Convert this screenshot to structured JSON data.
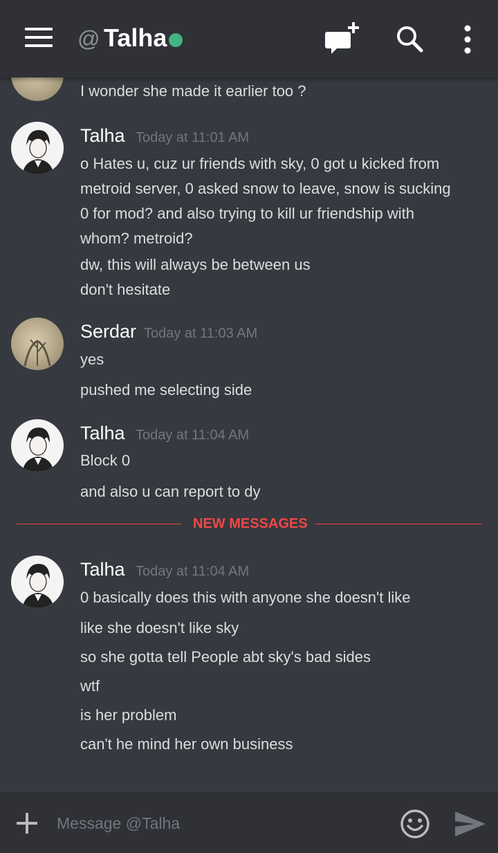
{
  "header": {
    "at_prefix": "@",
    "title": "Talha",
    "status": "online",
    "status_color": "#43b581",
    "icons": [
      "menu-icon",
      "new-dm-icon",
      "search-icon",
      "more-icon"
    ]
  },
  "messages": [
    {
      "author": "",
      "timestamp": "",
      "lines": [
        "I wonder she made it earlier too ?"
      ]
    },
    {
      "author": "Talha",
      "timestamp": "Today at 11:01 AM",
      "lines": [
        "o Hates u, cuz ur friends with sky, 0 got u kicked from",
        "metroid server, 0 asked snow to leave, snow is sucking",
        "0 for mod? and also trying to kill ur friendship with",
        "whom? metroid?",
        "dw, this will always be between us",
        "don't hesitate"
      ]
    },
    {
      "author": "Serdar",
      "timestamp": "Today at 11:03 AM",
      "lines": [
        "yes",
        "pushed me selecting side"
      ]
    },
    {
      "author": "Talha",
      "timestamp": "Today at 11:04 AM",
      "lines": [
        "Block 0",
        "and also u can report to dy"
      ]
    },
    {
      "author": "Talha",
      "timestamp": "Today at 11:04 AM",
      "lines": [
        "0 basically does this with anyone she doesn't like",
        "like she doesn't like sky",
        "so she gotta tell People abt sky's bad sides",
        "wtf",
        "is her problem",
        "can't he mind her own business"
      ]
    }
  ],
  "divider": {
    "label": "NEW MESSAGES",
    "color": "#f04747"
  },
  "composer": {
    "placeholder": "Message @Talha",
    "value": ""
  }
}
